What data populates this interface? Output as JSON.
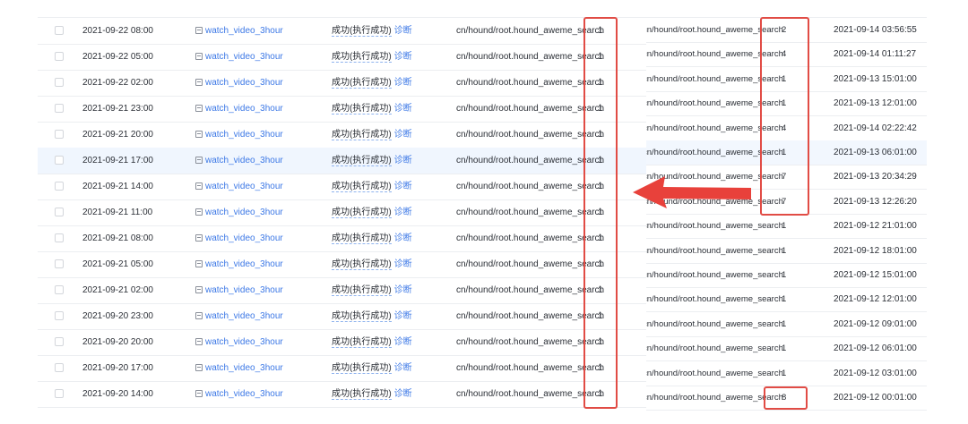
{
  "left_table": {
    "rows": [
      {
        "time": "2021-09-22 08:00",
        "task": "watch_video_3hour",
        "status": "成功(执行成功)",
        "action": "诊断",
        "path": "cn/hound/root.hound_aweme_search",
        "count": "1"
      },
      {
        "time": "2021-09-22 05:00",
        "task": "watch_video_3hour",
        "status": "成功(执行成功)",
        "action": "诊断",
        "path": "cn/hound/root.hound_aweme_search",
        "count": "1"
      },
      {
        "time": "2021-09-22 02:00",
        "task": "watch_video_3hour",
        "status": "成功(执行成功)",
        "action": "诊断",
        "path": "cn/hound/root.hound_aweme_search",
        "count": "1"
      },
      {
        "time": "2021-09-21 23:00",
        "task": "watch_video_3hour",
        "status": "成功(执行成功)",
        "action": "诊断",
        "path": "cn/hound/root.hound_aweme_search",
        "count": "1"
      },
      {
        "time": "2021-09-21 20:00",
        "task": "watch_video_3hour",
        "status": "成功(执行成功)",
        "action": "诊断",
        "path": "cn/hound/root.hound_aweme_search",
        "count": "1"
      },
      {
        "time": "2021-09-21 17:00",
        "task": "watch_video_3hour",
        "status": "成功(执行成功)",
        "action": "诊断",
        "path": "cn/hound/root.hound_aweme_search",
        "count": "1"
      },
      {
        "time": "2021-09-21 14:00",
        "task": "watch_video_3hour",
        "status": "成功(执行成功)",
        "action": "诊断",
        "path": "cn/hound/root.hound_aweme_search",
        "count": "1"
      },
      {
        "time": "2021-09-21 11:00",
        "task": "watch_video_3hour",
        "status": "成功(执行成功)",
        "action": "诊断",
        "path": "cn/hound/root.hound_aweme_search",
        "count": "1"
      },
      {
        "time": "2021-09-21 08:00",
        "task": "watch_video_3hour",
        "status": "成功(执行成功)",
        "action": "诊断",
        "path": "cn/hound/root.hound_aweme_search",
        "count": "1"
      },
      {
        "time": "2021-09-21 05:00",
        "task": "watch_video_3hour",
        "status": "成功(执行成功)",
        "action": "诊断",
        "path": "cn/hound/root.hound_aweme_search",
        "count": "1"
      },
      {
        "time": "2021-09-21 02:00",
        "task": "watch_video_3hour",
        "status": "成功(执行成功)",
        "action": "诊断",
        "path": "cn/hound/root.hound_aweme_search",
        "count": "1"
      },
      {
        "time": "2021-09-20 23:00",
        "task": "watch_video_3hour",
        "status": "成功(执行成功)",
        "action": "诊断",
        "path": "cn/hound/root.hound_aweme_search",
        "count": "1"
      },
      {
        "time": "2021-09-20 20:00",
        "task": "watch_video_3hour",
        "status": "成功(执行成功)",
        "action": "诊断",
        "path": "cn/hound/root.hound_aweme_search",
        "count": "1"
      },
      {
        "time": "2021-09-20 17:00",
        "task": "watch_video_3hour",
        "status": "成功(执行成功)",
        "action": "诊断",
        "path": "cn/hound/root.hound_aweme_search",
        "count": "1"
      },
      {
        "time": "2021-09-20 14:00",
        "task": "watch_video_3hour",
        "status": "成功(执行成功)",
        "action": "诊断",
        "path": "cn/hound/root.hound_aweme_search",
        "count": "1"
      }
    ]
  },
  "right_table": {
    "rows": [
      {
        "path": "cn/hound/root.hound_aweme_search",
        "count": "2",
        "time": "2021-09-14 03:56:55"
      },
      {
        "path": "cn/hound/root.hound_aweme_search",
        "count": "4",
        "time": "2021-09-14 01:11:27"
      },
      {
        "path": "cn/hound/root.hound_aweme_search",
        "count": "1",
        "time": "2021-09-13 15:01:00"
      },
      {
        "path": "cn/hound/root.hound_aweme_search",
        "count": "1",
        "time": "2021-09-13 12:01:00"
      },
      {
        "path": "cn/hound/root.hound_aweme_search",
        "count": "4",
        "time": "2021-09-14 02:22:42"
      },
      {
        "path": "cn/hound/root.hound_aweme_search",
        "count": "1",
        "time": "2021-09-13 06:01:00"
      },
      {
        "path": "cn/hound/root.hound_aweme_search",
        "count": "7",
        "time": "2021-09-13 20:34:29"
      },
      {
        "path": "cn/hound/root.hound_aweme_search",
        "count": "7",
        "time": "2021-09-13 12:26:20"
      },
      {
        "path": "cn/hound/root.hound_aweme_search",
        "count": "1",
        "time": "2021-09-12 21:01:00"
      },
      {
        "path": "cn/hound/root.hound_aweme_search",
        "count": "1",
        "time": "2021-09-12 18:01:00"
      },
      {
        "path": "cn/hound/root.hound_aweme_search",
        "count": "1",
        "time": "2021-09-12 15:01:00"
      },
      {
        "path": "cn/hound/root.hound_aweme_search",
        "count": "1",
        "time": "2021-09-12 12:01:00"
      },
      {
        "path": "cn/hound/root.hound_aweme_search",
        "count": "1",
        "time": "2021-09-12 09:01:00"
      },
      {
        "path": "cn/hound/root.hound_aweme_search",
        "count": "1",
        "time": "2021-09-12 06:01:00"
      },
      {
        "path": "cn/hound/root.hound_aweme_search",
        "count": "1",
        "time": "2021-09-12 03:01:00"
      },
      {
        "path": "cn/hound/root.hound_aweme_search",
        "count": "8",
        "time": "2021-09-12 00:01:00"
      }
    ]
  },
  "annotations": {
    "box_color": "#e14c45",
    "arrow_color": "#e8413b",
    "highlight_color": "#f0f6fe"
  }
}
